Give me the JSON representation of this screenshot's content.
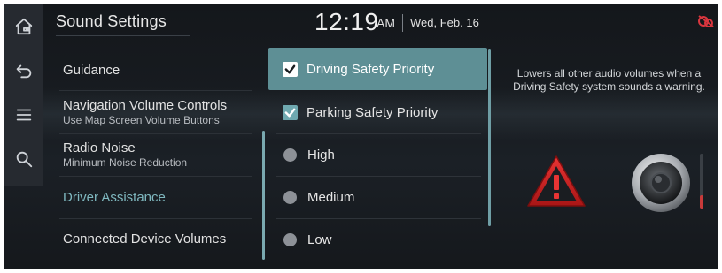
{
  "header": {
    "title": "Sound Settings",
    "time": "12:19",
    "ampm": "AM",
    "date": "Wed, Feb. 16"
  },
  "rail": {
    "icons": [
      "home-icon",
      "back-icon",
      "menu-icon",
      "search-icon"
    ]
  },
  "categories": [
    {
      "label": "Guidance",
      "sub": ""
    },
    {
      "label": "Navigation Volume Controls",
      "sub": "Use Map Screen Volume Buttons"
    },
    {
      "label": "Radio Noise",
      "sub": "Minimum Noise Reduction"
    },
    {
      "label": "Driver Assistance",
      "sub": "",
      "active": true
    },
    {
      "label": "Connected Device Volumes",
      "sub": ""
    }
  ],
  "options": [
    {
      "label": "Driving Safety Priority",
      "type": "checkbox",
      "checked": true,
      "highlighted": true
    },
    {
      "label": "Parking Safety Priority",
      "type": "checkbox",
      "checked": true
    },
    {
      "label": "High",
      "type": "radio",
      "selected": false
    },
    {
      "label": "Medium",
      "type": "radio",
      "selected": false
    },
    {
      "label": "Low",
      "type": "radio",
      "selected": false
    }
  ],
  "description": "Lowers all other audio volumes when a Driving Safety system sounds a warning.",
  "volume_level": 0.25,
  "colors": {
    "accent": "#5e8f95",
    "active_text": "#7fb8bf",
    "warning_red": "#d42a2a",
    "status_red": "#d9363e"
  }
}
